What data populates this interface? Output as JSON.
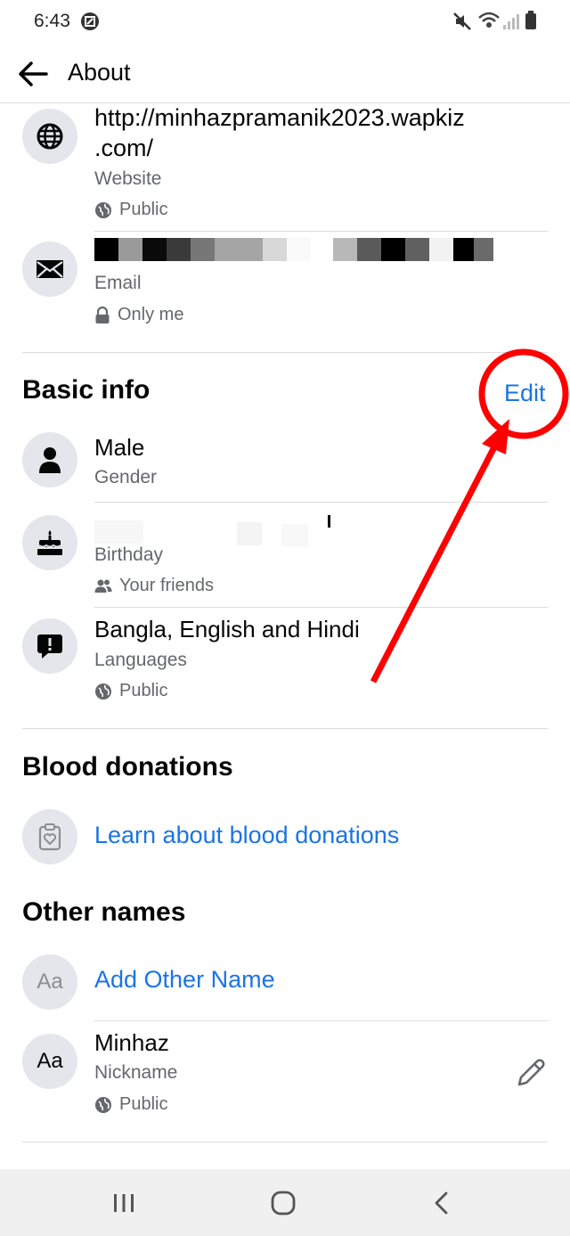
{
  "status_bar": {
    "time": "6:43"
  },
  "app_bar": {
    "title": "About"
  },
  "contact": {
    "website": {
      "url_line1": "http://minhazpramanik2023.wapkiz",
      "url_line2": ".com/",
      "label": "Website",
      "privacy": "Public"
    },
    "email": {
      "label": "Email",
      "privacy": "Only me"
    }
  },
  "basic_info": {
    "heading": "Basic info",
    "edit_label": "Edit",
    "gender": {
      "value": "Male",
      "label": "Gender"
    },
    "birthday": {
      "label": "Birthday",
      "privacy": "Your friends"
    },
    "languages": {
      "value": "Bangla, English and Hindi",
      "label": "Languages",
      "privacy": "Public"
    }
  },
  "blood_donations": {
    "heading": "Blood donations",
    "link": "Learn about blood donations"
  },
  "other_names": {
    "heading": "Other names",
    "add_label": "Add Other Name",
    "add_icon_text": "Aa",
    "nickname": {
      "icon_text": "Aa",
      "value": "Minhaz",
      "label": "Nickname",
      "privacy": "Public"
    }
  },
  "colors": {
    "link_blue": "#1b74e4",
    "annotation_red": "#ff0000",
    "icon_bg": "#e4e6eb"
  }
}
